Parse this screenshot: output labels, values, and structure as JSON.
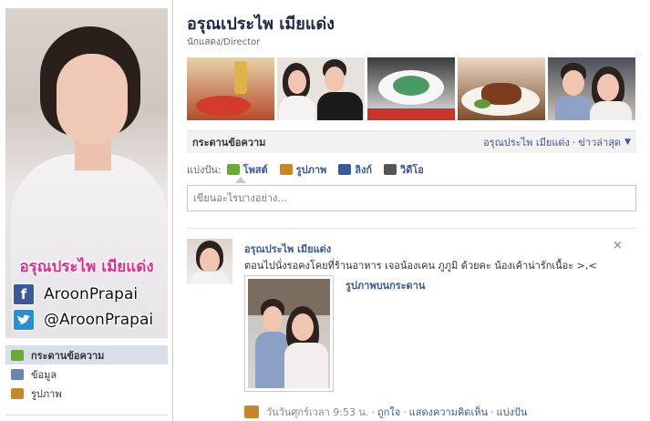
{
  "page": {
    "title": "อรุณเประไพ เมียแด่ง",
    "subtitle": "นักแสดง/Director"
  },
  "profile_picture": {
    "name_overlay": "อรุณประไพ เมียแด่ง",
    "facebook_handle": "AroonPrapai",
    "twitter_handle": "@AroonPrapai",
    "facebook_icon": "facebook-icon",
    "twitter_icon": "twitter-icon"
  },
  "left_nav": {
    "items": [
      {
        "label": "กระดานข้อความ",
        "icon": "wall-icon",
        "active": true
      },
      {
        "label": "ข้อมูล",
        "icon": "info-icon",
        "active": false
      },
      {
        "label": "รูปภาพ",
        "icon": "photos-icon",
        "active": false
      }
    ]
  },
  "photo_strip": {
    "photos": [
      {
        "description": "food-dish",
        "color": "#c9a27a"
      },
      {
        "description": "couple-portrait",
        "color": "#d9cfc8"
      },
      {
        "description": "green-dish",
        "color": "#b9d8c8"
      },
      {
        "description": "steak-plate",
        "color": "#c0523a"
      },
      {
        "description": "couple-selfie",
        "color": "#a9a39f"
      }
    ]
  },
  "wall": {
    "title": "กระดานข้อความ",
    "filter_owner": "อรุณประไพ เมียแด่ง",
    "filter_separator": "·",
    "filter_sort": "ข่าวล่าสุด",
    "caret": "▼"
  },
  "share": {
    "label": "แบ่งปัน:",
    "items": [
      {
        "label": "โพสต์",
        "icon": "status-icon",
        "color": "#6aaa3a"
      },
      {
        "label": "รูปภาพ",
        "icon": "photo-icon",
        "color": "#c8862a"
      },
      {
        "label": "ลิงก์",
        "icon": "link-icon",
        "color": "#3b5998"
      },
      {
        "label": "วิดีโอ",
        "icon": "video-icon",
        "color": "#555555"
      }
    ],
    "composer_placeholder": "เขียนอะไรบางอย่าง..."
  },
  "post": {
    "author": "อรุณประไพ เมียแด่ง",
    "text": "ตอนไปนั่งรอคงโคยที่ร้านอาหาร เจอน้องเคน ภูภูมิ ด้วยคะ น้องเค้าน่ารักเนื้อะ >,<",
    "close": "×",
    "album_link": "รูปภาพบนกระดาน",
    "timestamp": "วันวันศุกร์เวลา 9:53 น.",
    "actions": [
      "ถูกใจ",
      "แสดงความคิดเห็น",
      "แบ่งปัน"
    ],
    "separator": "·"
  },
  "colors": {
    "link": "#3b5998",
    "title": "#1c2a47",
    "active_nav": "#d8dfea",
    "overlay_name": "#e22c8f"
  }
}
